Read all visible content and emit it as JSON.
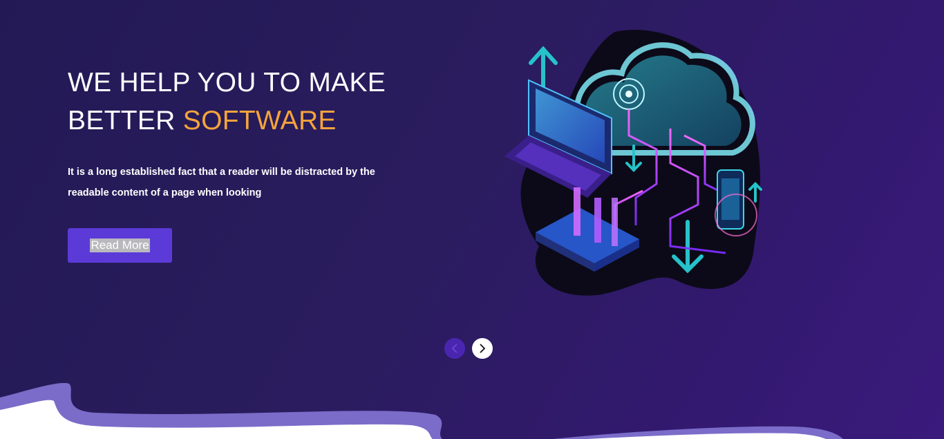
{
  "hero": {
    "headline_line1": "WE HELP YOU TO MAKE",
    "headline_line2_prefix": "BETTER",
    "headline_line2_accent": "SOFTWARE",
    "description_line1": "It is a long established fact that a reader will be distracted by the",
    "description_line2": "readable content of a page when looking",
    "button_label": "Read More"
  },
  "carousel": {
    "prev_icon": "chevron-left-icon",
    "next_icon": "chevron-right-icon"
  },
  "colors": {
    "accent": "#f5a43c",
    "button": "#5b3ad8",
    "background": "#2a1c5e",
    "wave": "#7b6cc9"
  },
  "illustration": {
    "icon": "cloud-computing-illustration"
  }
}
